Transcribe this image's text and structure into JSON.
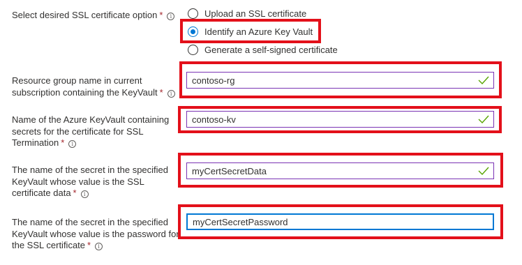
{
  "ssl_option": {
    "label": "Select desired SSL certificate option",
    "required_mark": "*",
    "info_icon": "info-icon",
    "options": [
      {
        "label": "Upload an SSL certificate",
        "selected": false
      },
      {
        "label": "Identify an Azure Key Vault",
        "selected": true
      },
      {
        "label": "Generate a self-signed certificate",
        "selected": false
      }
    ]
  },
  "fields": [
    {
      "label_lines": [
        "Resource group name in current",
        "subscription containing the KeyVault"
      ],
      "required_mark": "*",
      "value": "contoso-rg",
      "valid": true
    },
    {
      "label_lines": [
        "Name of the Azure KeyVault containing",
        "secrets for the certificate for SSL",
        "Termination"
      ],
      "required_mark": "*",
      "value": "contoso-kv",
      "valid": true
    },
    {
      "label_lines": [
        "The name of the secret in the specified",
        "KeyVault whose value is the SSL",
        "certificate data"
      ],
      "required_mark": "*",
      "value": "myCertSecretData",
      "valid": true
    },
    {
      "label_lines": [
        "The name of the secret in the specified",
        "KeyVault whose value is the password for",
        "the SSL certificate"
      ],
      "required_mark": "*",
      "value": "myCertSecretPassword",
      "valid": false,
      "focused": true
    }
  ],
  "colors": {
    "highlight": "#e3101a",
    "accent": "#0078d4",
    "valid_check": "#57a300",
    "required": "#a4262c"
  }
}
